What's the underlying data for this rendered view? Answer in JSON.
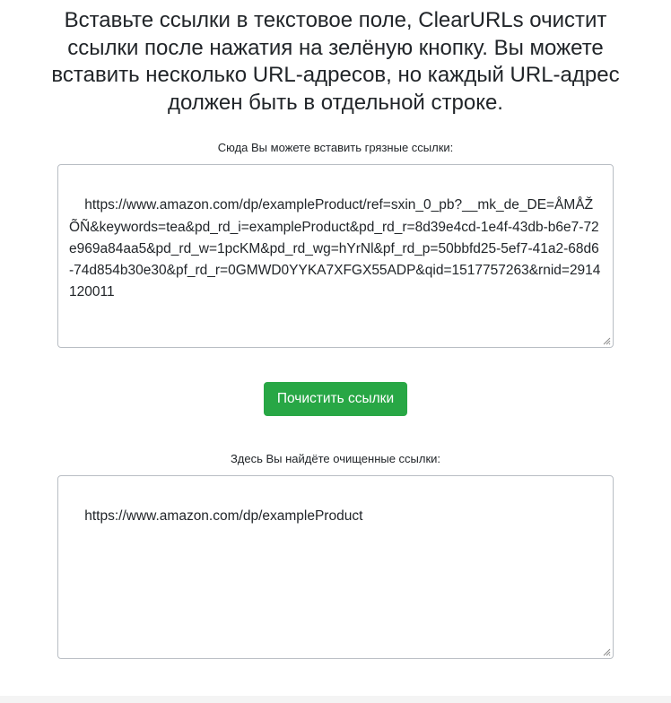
{
  "intro": {
    "text": "Вставьте ссылки в текстовое поле, ClearURLs очистит ссылки после нажатия на зелёную кнопку. Вы можете вставить несколько URL-адресов, но каждый URL-адрес должен быть в отдельной строке."
  },
  "dirty": {
    "label": "Сюда Вы можете вставить грязные ссылки:",
    "value": "https://www.amazon.com/dp/exampleProduct/ref=sxin_0_pb?__mk_de_DE=ÅMÅŽÕÑ&keywords=tea&pd_rd_i=exampleProduct&pd_rd_r=8d39e4cd-1e4f-43db-b6e7-72e969a84aa5&pd_rd_w=1pcKM&pd_rd_wg=hYrNl&pf_rd_p=50bbfd25-5ef7-41a2-68d6-74d854b30e30&pf_rd_r=0GMWD0YYKA7XFGX55ADP&qid=1517757263&rnid=2914120011"
  },
  "button": {
    "label": "Почистить ссылки",
    "color": "#28a745"
  },
  "clean": {
    "label": "Здесь Вы найдёте очищенные ссылки:",
    "value": "https://www.amazon.com/dp/exampleProduct"
  }
}
